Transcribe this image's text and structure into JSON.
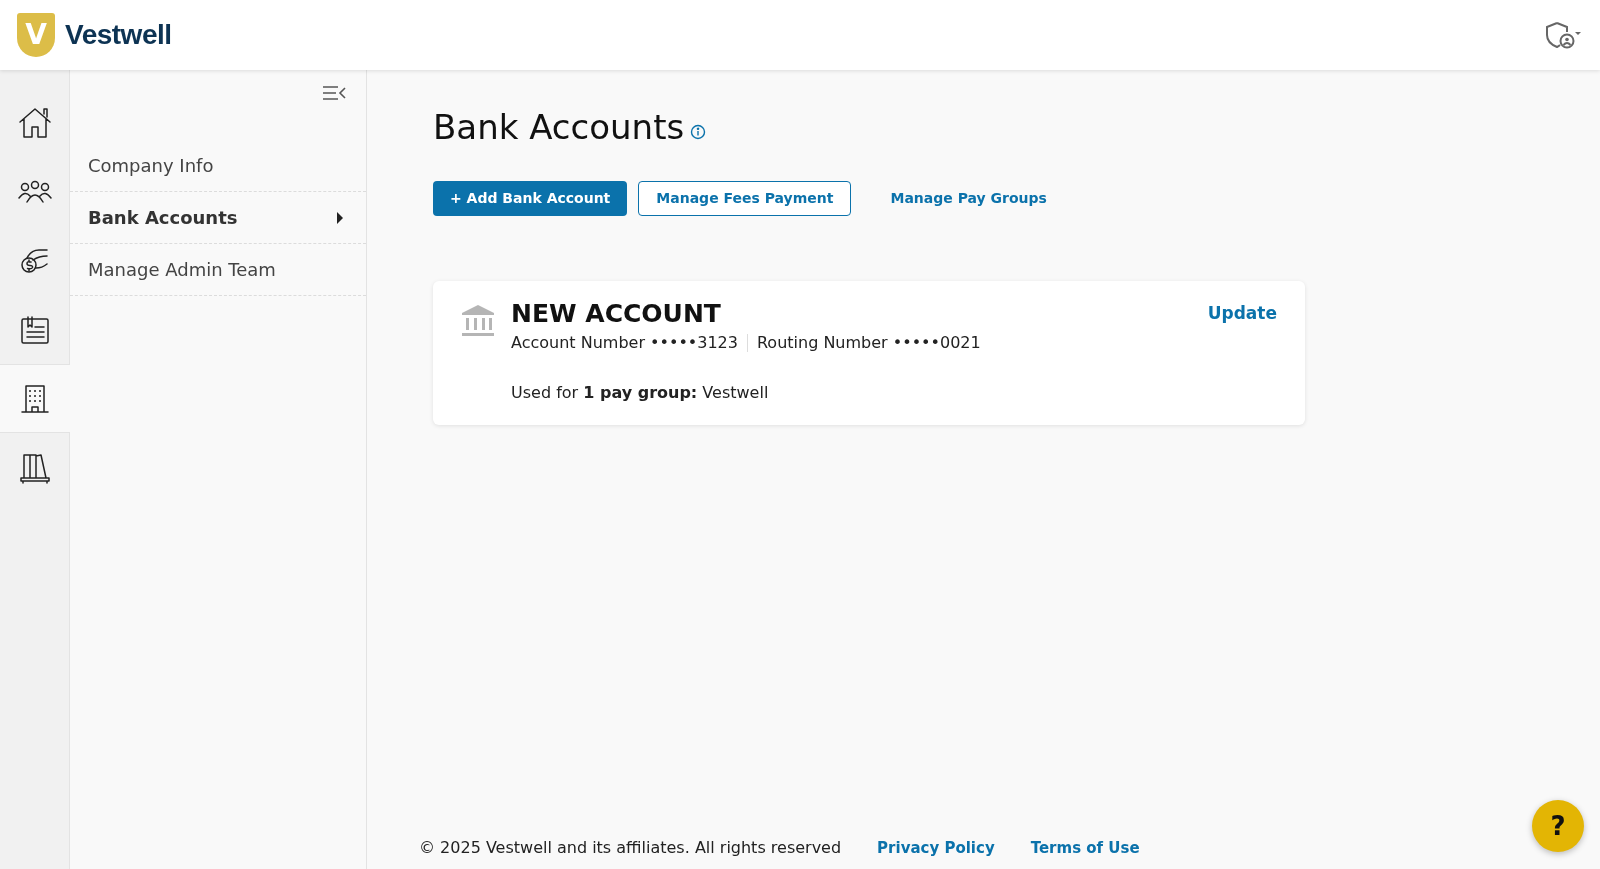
{
  "header": {
    "logo_letter": "V",
    "logo_name": "Vestwell"
  },
  "rail": [
    {
      "kind": "home",
      "selected": false
    },
    {
      "kind": "people",
      "selected": false
    },
    {
      "kind": "money",
      "selected": false
    },
    {
      "kind": "document",
      "selected": false
    },
    {
      "kind": "building",
      "selected": true
    },
    {
      "kind": "books",
      "selected": false
    }
  ],
  "subnav": [
    {
      "label": "Company Info",
      "selected": false
    },
    {
      "label": "Bank Accounts",
      "selected": true
    },
    {
      "label": "Manage Admin Team",
      "selected": false
    }
  ],
  "page": {
    "title": "Bank Accounts"
  },
  "actions": [
    {
      "kind": "primary",
      "label": "+ Add Bank Account"
    },
    {
      "kind": "outline",
      "label": "Manage Fees Payment"
    },
    {
      "kind": "link",
      "label": "Manage Pay Groups"
    }
  ],
  "accounts": [
    {
      "name": "NEW ACCOUNT",
      "account_label": "Account Number",
      "account_number": "•••••3123",
      "routing_label": "Routing Number",
      "routing_number": "•••••0021",
      "usage": "Used for **1 pay group:** Vestwell",
      "action": "Update"
    }
  ],
  "footer": {
    "copyright": "© 2025 Vestwell and its affiliates. All rights reserved",
    "links": [
      "Privacy Policy",
      "Terms of Use"
    ]
  },
  "help": {
    "label": "?"
  }
}
